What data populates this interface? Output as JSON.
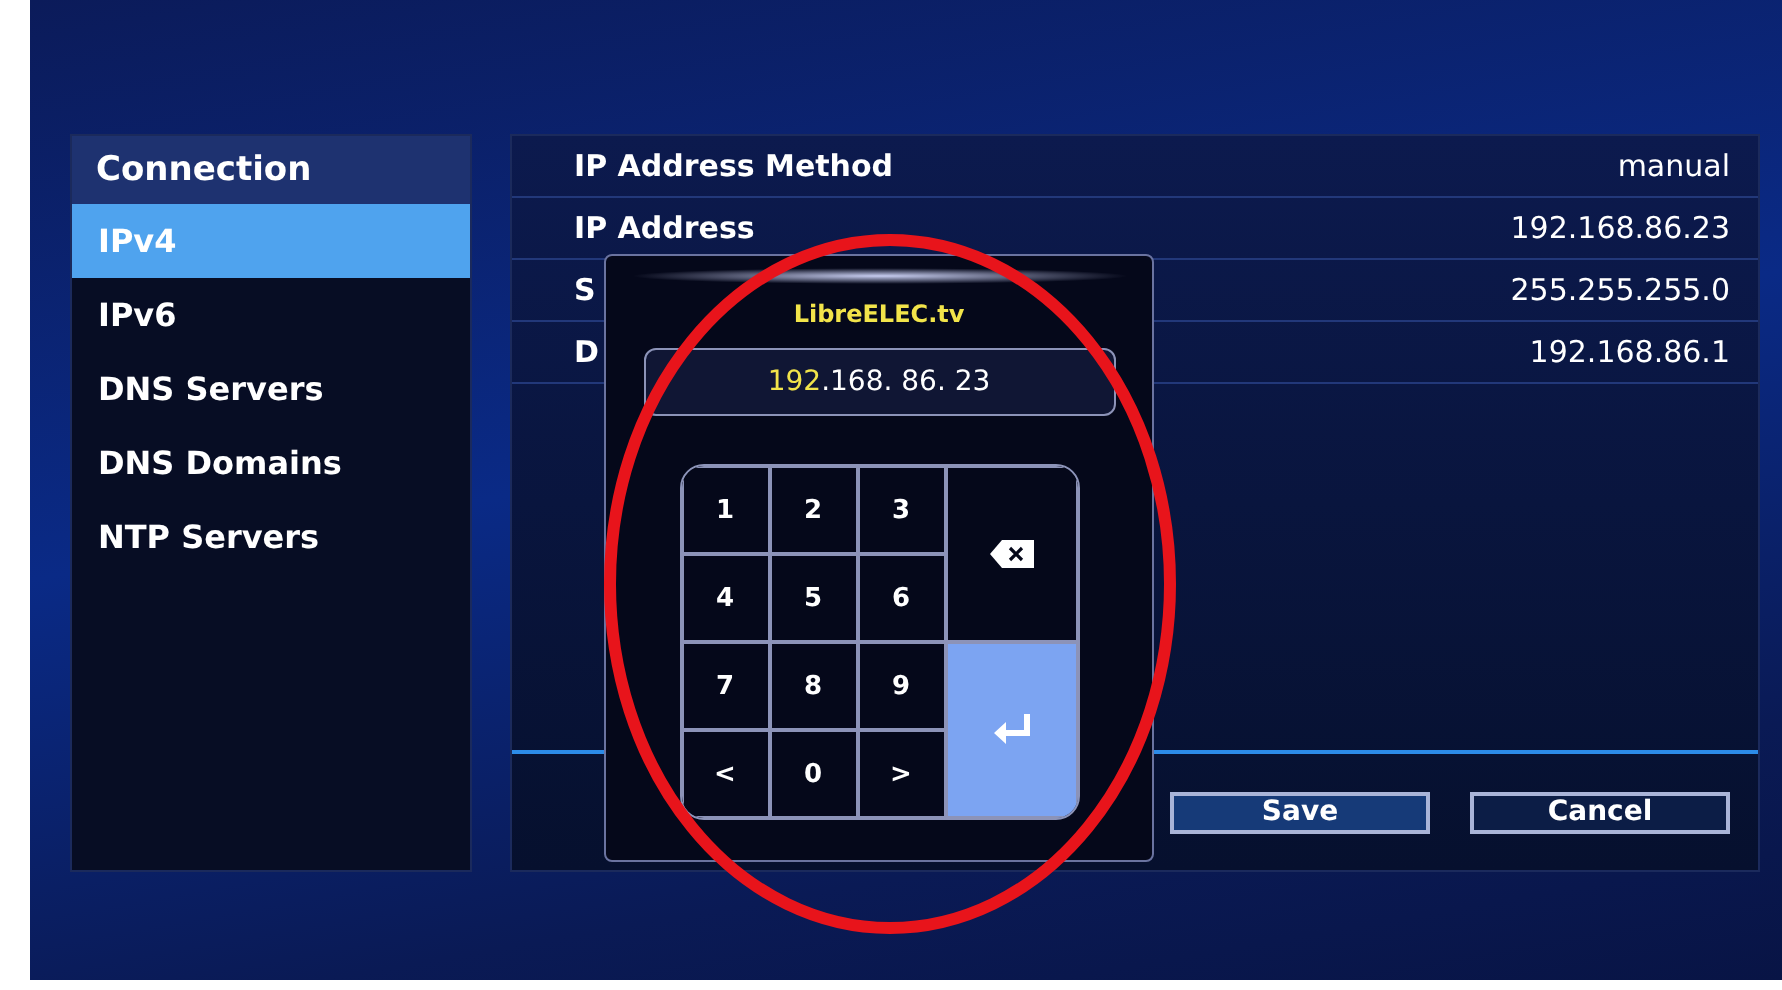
{
  "sidebar": {
    "title": "Connection",
    "items": [
      {
        "label": "IPv4",
        "selected": true
      },
      {
        "label": "IPv6",
        "selected": false
      },
      {
        "label": "DNS Servers",
        "selected": false
      },
      {
        "label": "DNS Domains",
        "selected": false
      },
      {
        "label": "NTP Servers",
        "selected": false
      }
    ]
  },
  "settings": [
    {
      "label": "IP Address Method",
      "value": "manual"
    },
    {
      "label": "IP Address",
      "value": "192.168.86.23"
    },
    {
      "label": "S",
      "value": "255.255.255.0"
    },
    {
      "label": "D",
      "value": "192.168.86.1"
    }
  ],
  "buttons": [
    {
      "label": "Save"
    },
    {
      "label": "Cancel"
    }
  ],
  "dialog": {
    "title": "LibreELEC.tv",
    "value_highlight": "192",
    "value_rest": ".168. 86. 23",
    "keys": [
      {
        "kind": "digit",
        "label": "1",
        "selected": false
      },
      {
        "kind": "digit",
        "label": "2",
        "selected": false
      },
      {
        "kind": "digit",
        "label": "3",
        "selected": false
      },
      {
        "kind": "backspace",
        "selected": false
      },
      {
        "kind": "digit",
        "label": "4",
        "selected": false
      },
      {
        "kind": "digit",
        "label": "5",
        "selected": false
      },
      {
        "kind": "digit",
        "label": "6",
        "selected": false
      },
      {
        "kind": "digit",
        "label": "7",
        "selected": false
      },
      {
        "kind": "digit",
        "label": "8",
        "selected": false
      },
      {
        "kind": "digit",
        "label": "9",
        "selected": false
      },
      {
        "kind": "enter",
        "selected": true
      },
      {
        "kind": "digit",
        "label": "<",
        "selected": false
      },
      {
        "kind": "digit",
        "label": "0",
        "selected": false
      },
      {
        "kind": "digit",
        "label": ">",
        "selected": false
      }
    ]
  }
}
